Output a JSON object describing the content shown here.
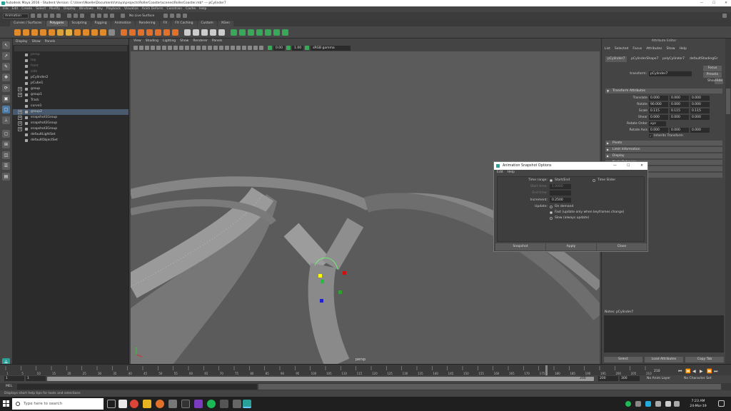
{
  "window": {
    "title": "Autodesk Maya 2016 - Student Version: C:\\Users\\Noelle\\Documents\\maya\\projects\\RollerCoaster\\scenes\\RollerCoaster.mb* --- pCylinder7",
    "minimize": "—",
    "maximize": "☐",
    "close": "✕"
  },
  "menubar": [
    "File",
    "Edit",
    "Create",
    "Select",
    "Modify",
    "Display",
    "Windows",
    "Key",
    "Playback",
    "Visualize",
    "Anim Deform",
    "Constrain",
    "Cache",
    "Help"
  ],
  "statusline": {
    "mode": "Animation",
    "live_surface": "No Live Surface"
  },
  "shelf": {
    "tabs": [
      "Curves / Surfaces",
      "Polygons",
      "Sculpting",
      "Rigging",
      "Animation",
      "Rendering",
      "FX",
      "FX Caching",
      "Custom",
      "XGen"
    ],
    "active_tab": "Polygons",
    "colors": [
      "#e08a2a",
      "#e08a2a",
      "#e08a2a",
      "#e08a2a",
      "#e08a2a",
      "#d9a23a",
      "#e0b040",
      "#e08a2a",
      "#e08a2a",
      "#e08a2a",
      "#e08a2a",
      "#888888",
      "#e0702a",
      "#e0702a",
      "#e0702a",
      "#e0702a",
      "#e0702a",
      "#e0702a",
      "#e0702a",
      "#cccccc",
      "#cccccc",
      "#cccccc",
      "#cccccc",
      "#cccccc",
      "#39a85a",
      "#39a85a",
      "#39a85a",
      "#39a85a",
      "#39a85a",
      "#39a85a",
      "#39a85a"
    ]
  },
  "outliner": {
    "menu": [
      "Display",
      "Show",
      "Panels"
    ],
    "items": [
      {
        "label": "persp",
        "hidden": true,
        "expandable": false,
        "selected": false
      },
      {
        "label": "top",
        "hidden": true,
        "expandable": false,
        "selected": false
      },
      {
        "label": "front",
        "hidden": true,
        "expandable": false,
        "selected": false
      },
      {
        "label": "side",
        "hidden": true,
        "expandable": false,
        "selected": false
      },
      {
        "label": "pCylinder2",
        "hidden": false,
        "expandable": false,
        "selected": false
      },
      {
        "label": "pCube1",
        "hidden": false,
        "expandable": false,
        "selected": false
      },
      {
        "label": "group",
        "hidden": false,
        "expandable": true,
        "selected": false
      },
      {
        "label": "group1",
        "hidden": false,
        "expandable": true,
        "selected": false
      },
      {
        "label": "Track",
        "hidden": false,
        "expandable": false,
        "selected": false
      },
      {
        "label": "curve1",
        "hidden": false,
        "expandable": false,
        "selected": false
      },
      {
        "label": "group2",
        "hidden": false,
        "expandable": true,
        "selected": true
      },
      {
        "label": "snapshot1Group",
        "hidden": false,
        "expandable": true,
        "selected": false
      },
      {
        "label": "snapshot2Group",
        "hidden": false,
        "expandable": true,
        "selected": false
      },
      {
        "label": "snapshot3Group",
        "hidden": false,
        "expandable": true,
        "selected": false
      },
      {
        "label": "defaultLightSet",
        "hidden": false,
        "expandable": false,
        "selected": false
      },
      {
        "label": "defaultObjectSet",
        "hidden": false,
        "expandable": false,
        "selected": false
      }
    ],
    "expand_glyph": "+"
  },
  "viewport": {
    "menu": [
      "View",
      "Shading",
      "Lighting",
      "Show",
      "Renderer",
      "Panels"
    ],
    "near": "0.00",
    "far": "1.00",
    "color_space": "sRGB gamma",
    "camera_label": "persp"
  },
  "attribute_editor": {
    "title": "Attribute Editor",
    "menu": [
      "List",
      "Selected",
      "Focus",
      "Attributes",
      "Show",
      "Help"
    ],
    "node_tabs": [
      "pCylinder7",
      "pCylinderShape7",
      "polyCylinder7",
      "default​ShadingGr"
    ],
    "transform_label": "transform:",
    "transform_value": "pCylinder7",
    "focus": "Focus",
    "presets": "Presets",
    "show": "Show",
    "hide": "Hide",
    "transform_section": "Transform Attributes",
    "rows": [
      {
        "label": "Translate",
        "values": [
          "0.000",
          "0.000",
          "0.000"
        ]
      },
      {
        "label": "Rotate",
        "values": [
          "90.000",
          "0.000",
          "0.000"
        ]
      },
      {
        "label": "Scale",
        "values": [
          "0.115",
          "0.115",
          "0.115"
        ]
      },
      {
        "label": "Shear",
        "values": [
          "0.000",
          "0.000",
          "0.000"
        ]
      }
    ],
    "rotate_order_label": "Rotate Order",
    "rotate_order": "xyz",
    "rotate_axis_label": "Rotate Axis",
    "rotate_axis": [
      "0.000",
      "0.000",
      "0.000"
    ],
    "inherits_check": "✓",
    "inherits": "Inherits Transform",
    "sections": [
      "Pivots",
      "Limit Information",
      "Display",
      "Node Behavior",
      "UUID",
      "Extra Attributes"
    ],
    "notes_label": "Notes: pCylinder7",
    "buttons": [
      "Select",
      "Load Attributes",
      "Copy Tab"
    ]
  },
  "timeslider": {
    "ticks": [
      "1",
      "5",
      "10",
      "15",
      "20",
      "25",
      "30",
      "35",
      "40",
      "45",
      "50",
      "55",
      "60",
      "65",
      "70",
      "75",
      "80",
      "85",
      "90",
      "95",
      "100",
      "105",
      "110",
      "115",
      "120",
      "125",
      "130",
      "135",
      "140",
      "145",
      "150",
      "155",
      "160",
      "165",
      "170",
      "175",
      "180",
      "185",
      "190",
      "195",
      "200",
      "205",
      "210"
    ],
    "current_frame": "210",
    "playback": [
      "⏮",
      "⏪",
      "◀",
      "▶",
      "⏩",
      "⏭"
    ]
  },
  "rangeslider": {
    "start": "1",
    "start2": "1",
    "range_end": "200",
    "end": "200",
    "end2": "300",
    "anim_layer": "No Anim Layer",
    "character": "No Character Set"
  },
  "cmdline": {
    "lang": "MEL"
  },
  "helpline": "Displays short help tips for tools and selections",
  "taskbar": {
    "search": "Type here to search",
    "time": "7:23 AM",
    "date": "24-Mar-19"
  },
  "dialog": {
    "title": "Animation Snapshot Options",
    "controls": {
      "minimize": "—",
      "maximize": "☐",
      "close": "✕"
    },
    "menu": [
      "Edit",
      "Help"
    ],
    "time_range_label": "Time range:",
    "time_range_start_end": "Start/End",
    "time_range_slider": "Time Slider",
    "start_time_label": "Start time:",
    "start_time_value": "1.0000",
    "end_time_label": "End time:",
    "increment_label": "Increment:",
    "increment_value": "0.2500",
    "update_label": "Update:",
    "update_on_demand": "On demand",
    "update_fast": "Fast (update only when keyframes change)",
    "update_always": "Slow (always update)",
    "buttons": [
      "Snapshot",
      "Apply",
      "Close"
    ]
  }
}
